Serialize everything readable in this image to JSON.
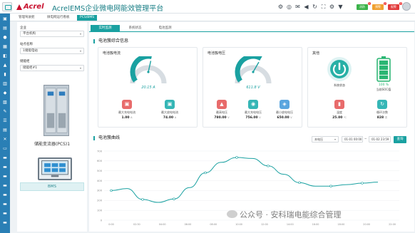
{
  "header": {
    "brand": "Acrel",
    "title": "AcrelEMS企业微电网能效管理平台",
    "badges": [
      {
        "text": "消防",
        "count": "1",
        "color": "#3cb34a"
      },
      {
        "text": "预警",
        "count": "2",
        "color": "#f0a030"
      },
      {
        "text": "报警",
        "count": "3",
        "color": "#e23a3a"
      }
    ]
  },
  "breadcrumbs": [
    "管理驾驶舱",
    "微电网运行看板",
    "PCS/BMS"
  ],
  "left": {
    "company_label": "企业",
    "company_value": "平台机构",
    "station_label": "站点名称",
    "station_value": "1储能电站",
    "cabinet_label": "储能柜",
    "cabinet_value": "储能柜#1",
    "pcs_label": "储能变流器(PCS)1",
    "bms_label": "BMS"
  },
  "tabs": [
    "实时监测",
    "系统状态",
    "电池监测"
  ],
  "cluster": {
    "section_title": "电池簇综合信息",
    "current_card": {
      "title": "电池簇电流",
      "gauge_value": "20.15 A",
      "gauge_fraction": 0.55,
      "stats": [
        {
          "label": "最大充电电流",
          "value": "1.00",
          "unit": "A"
        },
        {
          "label": "最大放电电流",
          "value": "74.00",
          "unit": "A"
        }
      ]
    },
    "voltage_card": {
      "title": "电池簇电压",
      "gauge_value": "611.8 V",
      "gauge_fraction": 0.62,
      "stats": [
        {
          "label": "最高电压",
          "value": "780.00",
          "unit": "V"
        },
        {
          "label": "最大充电电压",
          "value": "756.00",
          "unit": "V"
        },
        {
          "label": "最小放电电压",
          "value": "650.00",
          "unit": "V"
        }
      ]
    },
    "other_card": {
      "title": "其他",
      "status_label": "系统状态",
      "soc_value": "100 %",
      "soc_label": "当前SOC值",
      "stats": [
        {
          "label": "温度",
          "value": "25.00",
          "unit": "℃"
        },
        {
          "label": "循环次数",
          "value": "828",
          "unit": "次"
        }
      ]
    }
  },
  "curve": {
    "section_title": "电池簇曲线",
    "mode": "本电压",
    "date_start": "01-01 00:00",
    "date_end": "01-02 23:59",
    "query": "查询"
  },
  "chart_data": {
    "type": "line",
    "series": [
      {
        "values": [
          300,
          320,
          210,
          180,
          215,
          330,
          480,
          585,
          635,
          625,
          550,
          465,
          380,
          345,
          345,
          360,
          375,
          385
        ]
      }
    ],
    "x_ticks": [
      "0:00",
      "02:30",
      "04:00",
      "06:00",
      "08:00",
      "10:00",
      "12:00",
      "14:00",
      "16:00",
      "18:00",
      "20:00",
      "22:00"
    ],
    "ylim": [
      0,
      700
    ],
    "y_ticks": [
      0,
      100,
      200,
      300,
      400,
      500,
      600,
      700
    ],
    "color": "#1aa1a1",
    "grid": true
  },
  "watermark": "公众号 · 安科瑞电能综合管理",
  "colors": {
    "accent": "#1aa1a1",
    "sidebar": "#2a7fb5"
  }
}
